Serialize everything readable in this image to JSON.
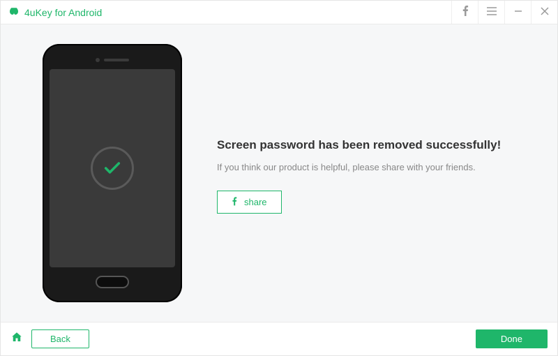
{
  "app": {
    "title": "4uKey for Android"
  },
  "titlebar": {
    "facebook": "facebook-icon",
    "menu": "menu-icon",
    "minimize": "minimize-icon",
    "close": "close-icon"
  },
  "message": {
    "heading": "Screen password has been removed successfully!",
    "sub": "If you think our product is helpful, please share with your friends.",
    "share_label": "share"
  },
  "footer": {
    "home": "home-icon",
    "back_label": "Back",
    "done_label": "Done"
  },
  "colors": {
    "accent": "#1fb66a"
  }
}
